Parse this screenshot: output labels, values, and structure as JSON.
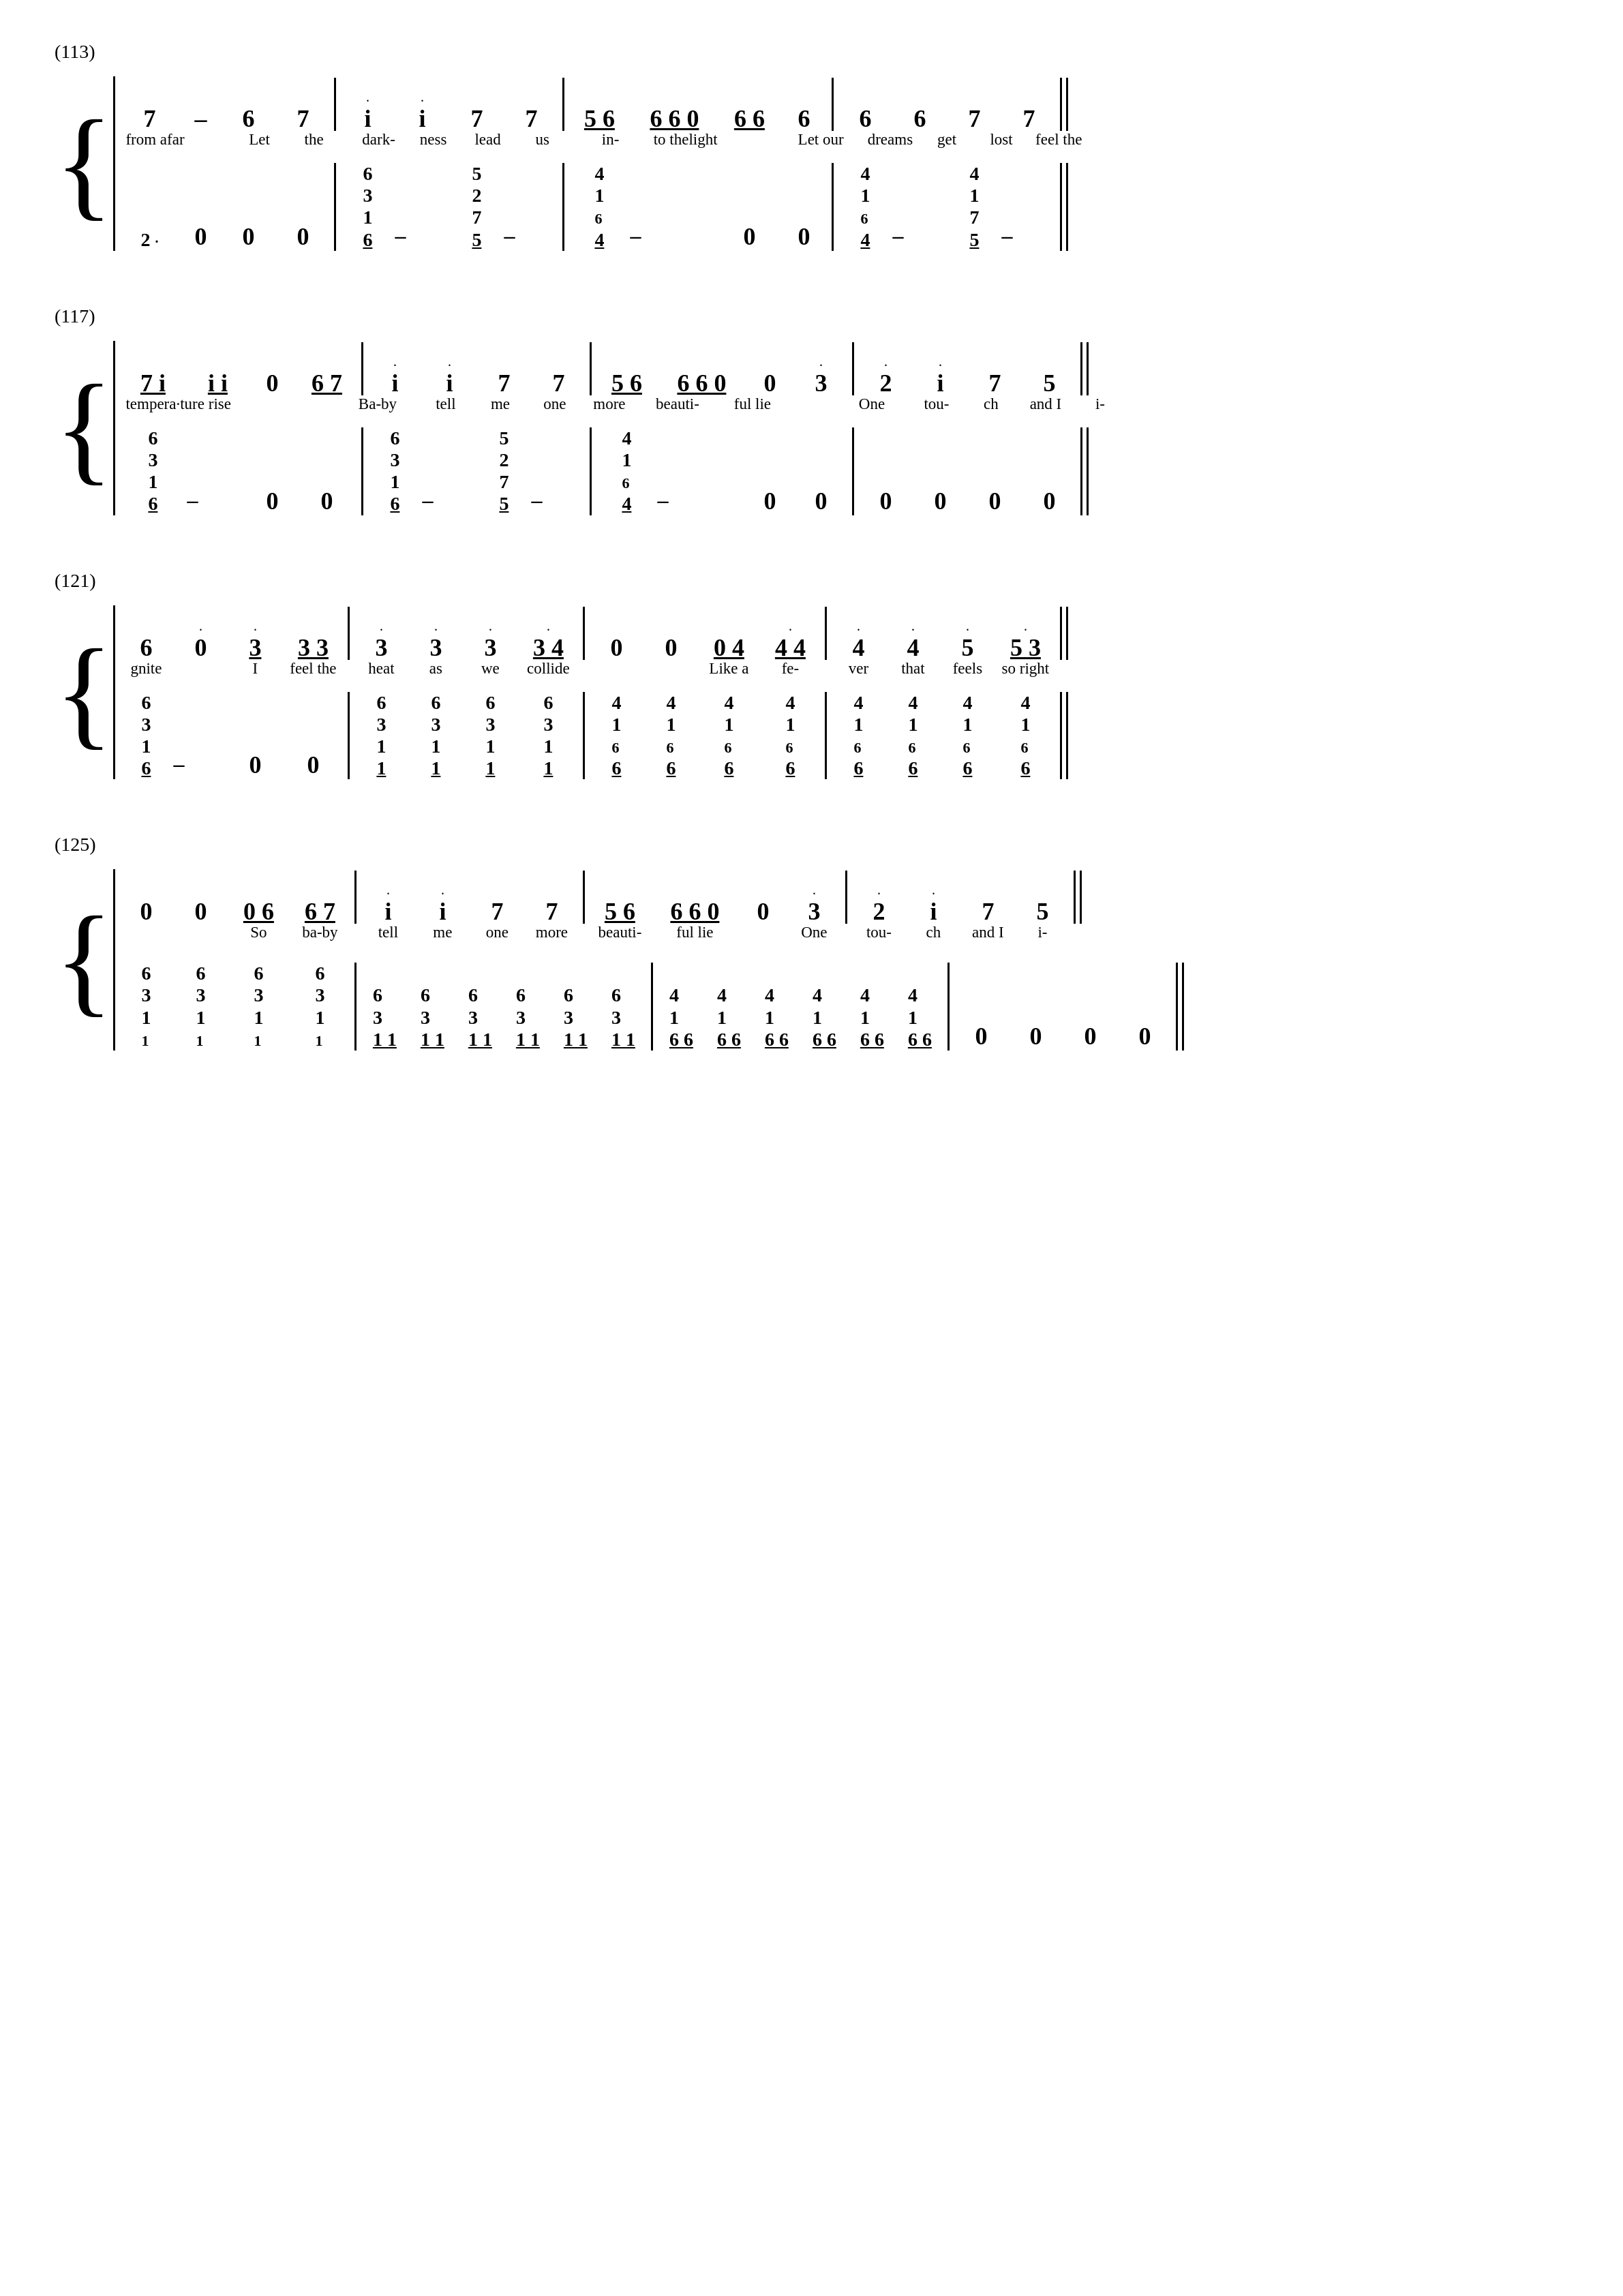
{
  "sections": [
    {
      "id": "113",
      "label": "(113)",
      "measures": {
        "treble": [
          [
            "7",
            "–",
            "6",
            "7"
          ],
          [
            "i·",
            "i·",
            "7",
            "7"
          ],
          [
            "5 6",
            "6 6 0",
            "6 6",
            "6",
            "6",
            "7",
            "7"
          ],
          []
        ]
      }
    }
  ]
}
